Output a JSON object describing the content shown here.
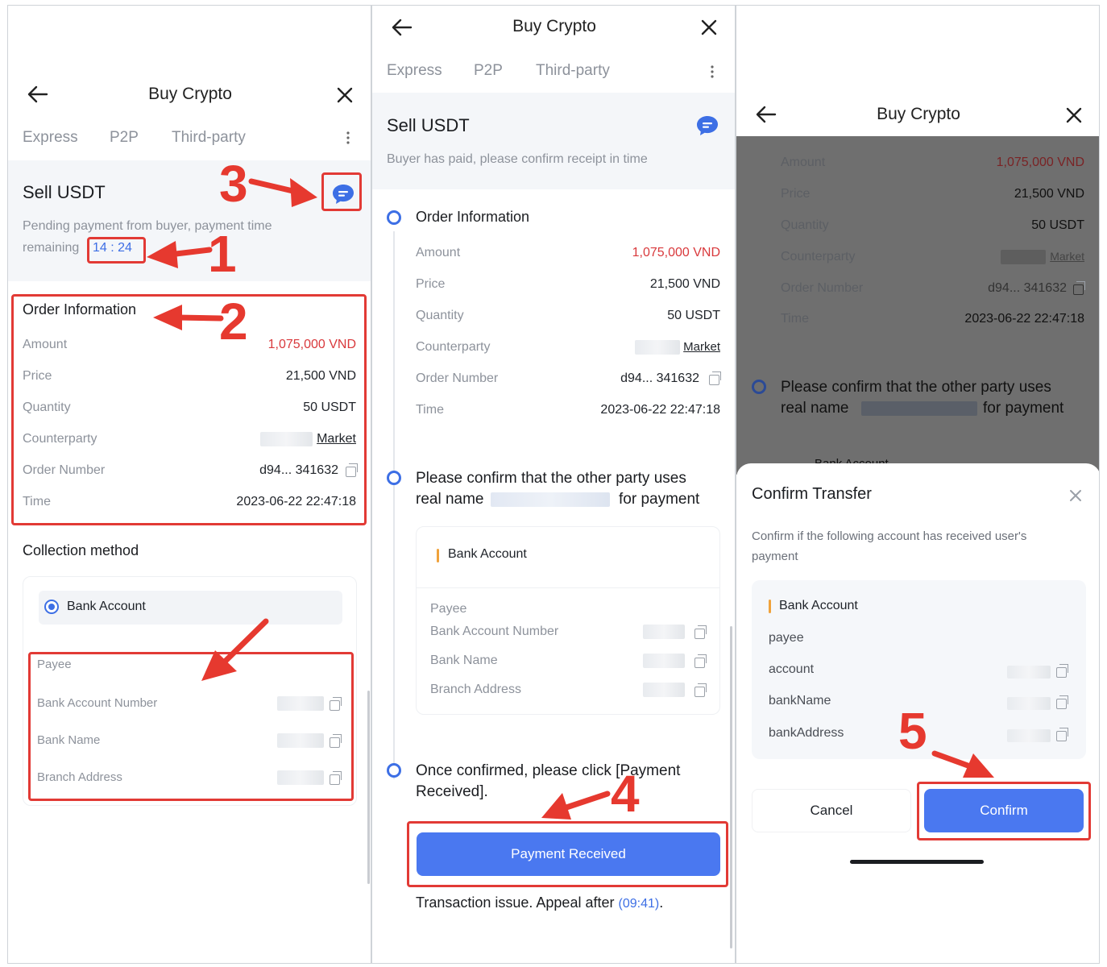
{
  "panel1": {
    "title": "Buy Crypto",
    "tabs": [
      "Express",
      "P2P",
      "Third-party"
    ],
    "sell_title": "Sell USDT",
    "pending_text_1": "Pending payment from buyer, payment time",
    "pending_text_2": "remaining",
    "timer": "14 : 24",
    "order_info_title": "Order Information",
    "rows": [
      {
        "label": "Amount",
        "value": "1,075,000 VND"
      },
      {
        "label": "Price",
        "value": "21,500 VND"
      },
      {
        "label": "Quantity",
        "value": "50 USDT"
      },
      {
        "label": "Counterparty",
        "value": "Market"
      },
      {
        "label": "Order Number",
        "value": "d94... 341632"
      },
      {
        "label": "Time",
        "value": "2023-06-22 22:47:18"
      }
    ],
    "collection_title": "Collection method",
    "bank_account": "Bank Account",
    "payee": "Payee",
    "bank_rows": [
      "Bank Account Number",
      "Bank Name",
      "Branch Address"
    ]
  },
  "panel2": {
    "title": "Buy Crypto",
    "tabs": [
      "Express",
      "P2P",
      "Third-party"
    ],
    "sell_title": "Sell USDT",
    "sub_text": "Buyer has paid, please confirm receipt in time",
    "order_info_title": "Order Information",
    "rows": [
      {
        "label": "Amount",
        "value": "1,075,000 VND"
      },
      {
        "label": "Price",
        "value": "21,500 VND"
      },
      {
        "label": "Quantity",
        "value": "50 USDT"
      },
      {
        "label": "Counterparty",
        "value": "Market"
      },
      {
        "label": "Order Number",
        "value": "d94... 341632"
      },
      {
        "label": "Time",
        "value": "2023-06-22 22:47:18"
      }
    ],
    "confirm_line1": "Please confirm that the other party uses",
    "confirm_line2a": "real name",
    "confirm_line2b": "for payment",
    "bank_account": "Bank Account",
    "payee": "Payee",
    "bank_rows": [
      "Bank Account Number",
      "Bank Name",
      "Branch Address"
    ],
    "once_line1": "Once confirmed, please click [Payment",
    "once_line2": "Received].",
    "button": "Payment Received",
    "appeal_text": "Transaction issue. Appeal after",
    "appeal_timer": "(09:41)",
    "appeal_end": "."
  },
  "panel3": {
    "title": "Buy Crypto",
    "rows": [
      {
        "label": "Amount",
        "value": "1,075,000 VND"
      },
      {
        "label": "Price",
        "value": "21,500 VND"
      },
      {
        "label": "Quantity",
        "value": "50 USDT"
      },
      {
        "label": "Counterparty",
        "value": "Market"
      },
      {
        "label": "Order Number",
        "value": "d94... 341632"
      },
      {
        "label": "Time",
        "value": "2023-06-22 22:47:18"
      }
    ],
    "confirm_line1": "Please confirm that the other party uses",
    "confirm_line2a": "real name",
    "confirm_line2b": "for payment",
    "peek_text": "Bank Account",
    "dialog_title": "Confirm Transfer",
    "dialog_sub_1": "Confirm if the following account has received user's",
    "dialog_sub_2": "payment",
    "bank_account": "Bank Account",
    "fields": [
      "payee",
      "account",
      "bankName",
      "bankAddress"
    ],
    "cancel": "Cancel",
    "confirm": "Confirm"
  },
  "annotations": {
    "n1": "1",
    "n2": "2",
    "n3": "3",
    "n4": "4",
    "n5": "5"
  },
  "colors": {
    "accent": "#4a78f0",
    "red_text": "#d9393c",
    "annotation": "#e23a35",
    "timer": "#3d6fe5"
  }
}
